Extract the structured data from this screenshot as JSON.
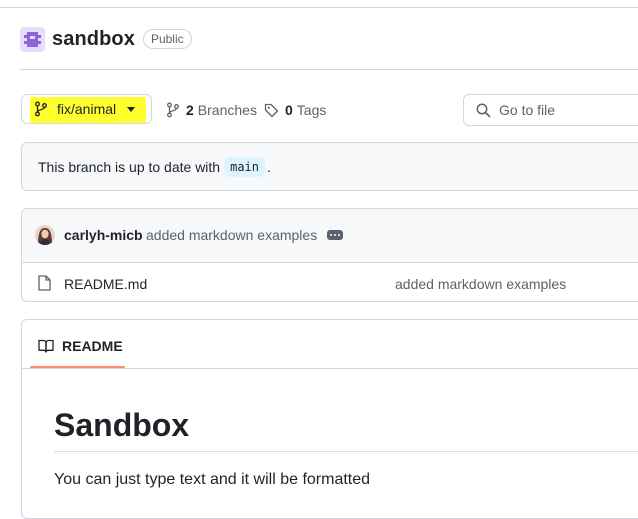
{
  "repo": {
    "name": "sandbox",
    "visibility": "Public"
  },
  "branch": {
    "current": "fix/animal",
    "highlight_color": "#ffff2e"
  },
  "stats": {
    "branch_count": "2",
    "branch_label": "Branches",
    "tag_count": "0",
    "tag_label": "Tags"
  },
  "search": {
    "placeholder": "Go to file"
  },
  "status": {
    "text": "This branch is up to date with",
    "base_branch": "main",
    "suffix": "."
  },
  "commit": {
    "author": "carlyh-micb",
    "message": "added markdown examples"
  },
  "files": [
    {
      "name": "README.md",
      "commit_message": "added markdown examples"
    }
  ],
  "readme": {
    "tab_label": "README",
    "heading": "Sandbox",
    "paragraph": "You can just type text and it will be formatted"
  },
  "icons": {
    "repo_avatar": "identicon",
    "branch": "git-branch-icon",
    "tag": "tag-icon",
    "search": "search-icon",
    "file": "file-icon",
    "book": "book-icon"
  }
}
